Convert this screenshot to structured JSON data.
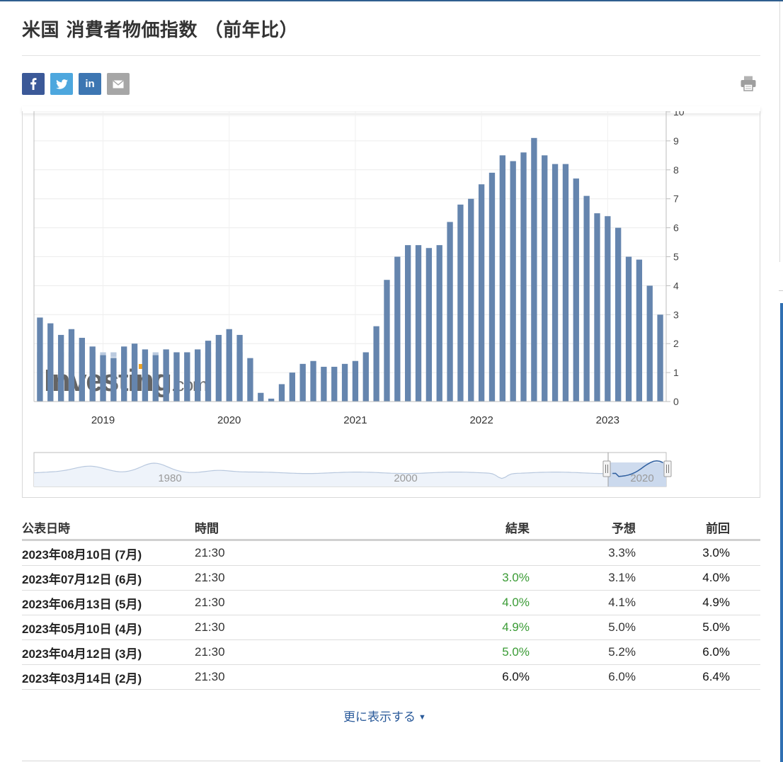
{
  "page": {
    "title": "米国 消費者物価指数 （前年比）",
    "more_label": "更に表示する",
    "colors": {
      "bar": "#6585ae",
      "bar_light": "#b4c4dc",
      "result_green": "#3a9b35",
      "facebook": "#3b5998",
      "twitter": "#4da7de",
      "linkedin": "#3d76b2",
      "email": "#a6a6a6"
    }
  },
  "share": {
    "icons": [
      "facebook-icon",
      "twitter-icon",
      "linkedin-icon",
      "email-icon",
      "print-icon"
    ],
    "linkedin_label": "in"
  },
  "chart_data": {
    "type": "bar",
    "watermark": "Investing.com",
    "y_ticks": [
      "0",
      "1",
      "2",
      "3",
      "4",
      "5",
      "6",
      "7",
      "8",
      "9",
      "10"
    ],
    "ylim": [
      0,
      10
    ],
    "x_ticks": [
      "2019",
      "2020",
      "2021",
      "2022",
      "2023"
    ],
    "grid": true,
    "values": [
      2.9,
      2.7,
      2.3,
      2.5,
      2.2,
      1.9,
      1.6,
      1.5,
      1.9,
      2.0,
      1.8,
      1.6,
      1.8,
      1.7,
      1.7,
      1.8,
      2.1,
      2.3,
      2.5,
      2.3,
      1.5,
      0.3,
      0.1,
      0.6,
      1.0,
      1.3,
      1.4,
      1.2,
      1.2,
      1.3,
      1.4,
      1.7,
      2.6,
      4.2,
      5.0,
      5.4,
      5.4,
      5.3,
      5.4,
      6.2,
      6.8,
      7.0,
      7.5,
      7.9,
      8.5,
      8.3,
      8.6,
      9.1,
      8.5,
      8.2,
      8.2,
      7.7,
      7.1,
      6.5,
      6.4,
      6.0,
      5.0,
      4.9,
      4.0,
      3.0
    ],
    "navigator": {
      "labels": [
        "1980",
        "2000",
        "2020"
      ]
    }
  },
  "table": {
    "headers": [
      "公表日時",
      "時間",
      "結果",
      "予想",
      "前回"
    ],
    "rows": [
      {
        "date": "2023年08月10日 (7月)",
        "time": "21:30",
        "actual": "",
        "forecast": "3.3%",
        "previous": "3.0%"
      },
      {
        "date": "2023年07月12日 (6月)",
        "time": "21:30",
        "actual": "3.0%",
        "forecast": "3.1%",
        "previous": "4.0%"
      },
      {
        "date": "2023年06月13日 (5月)",
        "time": "21:30",
        "actual": "4.0%",
        "forecast": "4.1%",
        "previous": "4.9%"
      },
      {
        "date": "2023年05月10日 (4月)",
        "time": "21:30",
        "actual": "4.9%",
        "forecast": "5.0%",
        "previous": "5.0%"
      },
      {
        "date": "2023年04月12日 (3月)",
        "time": "21:30",
        "actual": "5.0%",
        "forecast": "5.2%",
        "previous": "6.0%"
      },
      {
        "date": "2023年03月14日 (2月)",
        "time": "21:30",
        "actual": "6.0%",
        "forecast": "6.0%",
        "previous": "6.4%"
      }
    ]
  }
}
